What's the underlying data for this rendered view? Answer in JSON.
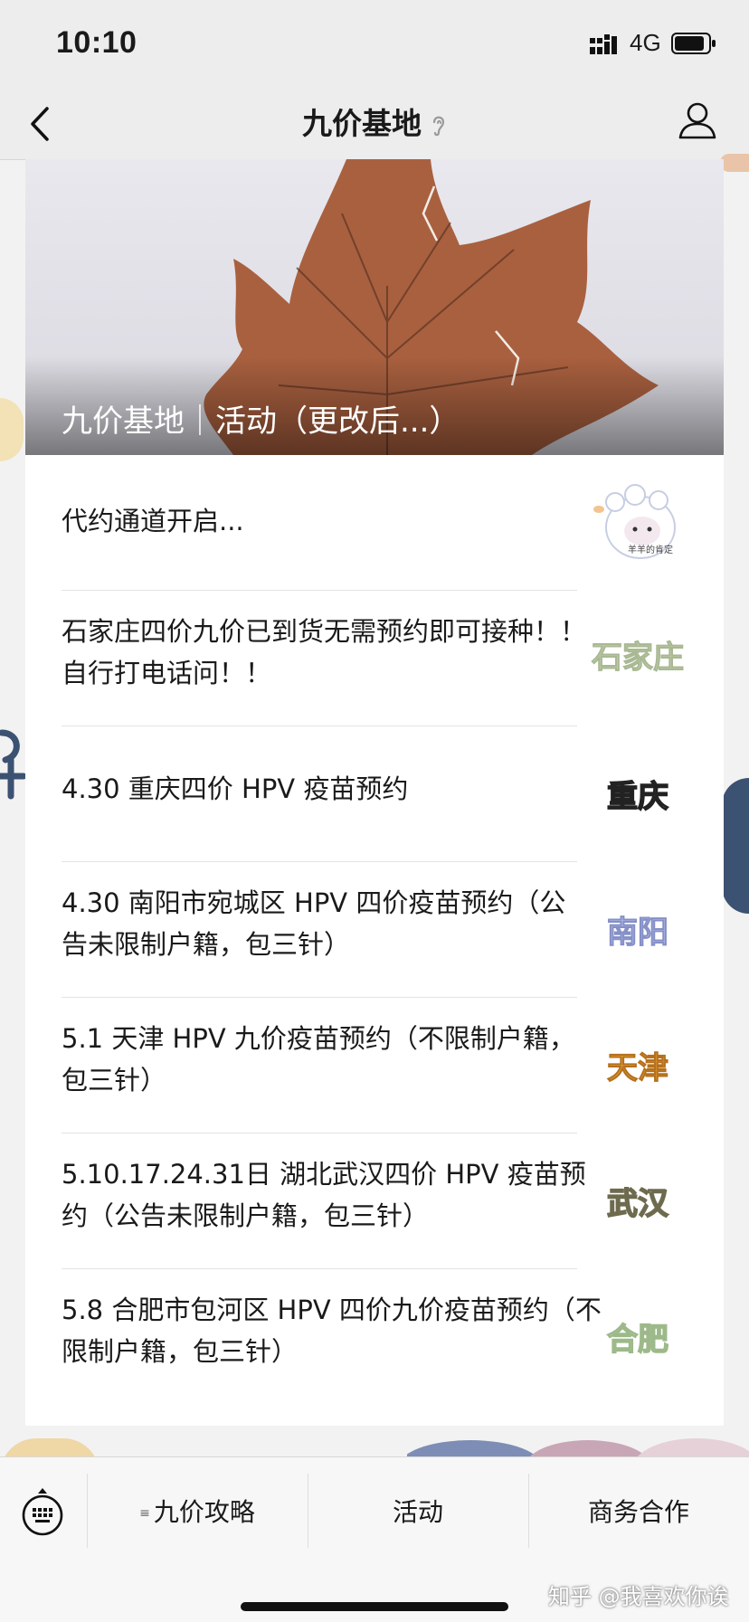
{
  "status": {
    "time": "10:10",
    "network": "4G"
  },
  "nav": {
    "title": "九价基地",
    "back_icon": "chevron-left-icon",
    "profile_icon": "person-icon",
    "ear_icon": "listen-icon"
  },
  "banner": {
    "title": "九价基地｜活动（更改后...）"
  },
  "articles": [
    {
      "title": "代约通道开启...",
      "thumb_label": "羊羊的肯定",
      "thumb_kind": "sheep-illustration"
    },
    {
      "title": "石家庄四价九价已到货无需预约即可接种！！自行打电话问！！",
      "thumb_label": "石家庄",
      "thumb_color": "#c8d6b2"
    },
    {
      "title": "4.30 重庆四价 HPV 疫苗预约",
      "thumb_label": "重庆",
      "thumb_color": "#f1d24a"
    },
    {
      "title": "4.30 南阳市宛城区 HPV 四价疫苗预约（公告未限制户籍，包三针）",
      "thumb_label": "南阳",
      "thumb_color": "#aeb8e6"
    },
    {
      "title": "5.1 天津 HPV 九价疫苗预约（不限制户籍，包三针）",
      "thumb_label": "天津",
      "thumb_color": "#f0a738"
    },
    {
      "title": "5.10.17.24.31日 湖北武汉四价 HPV 疫苗预约（公告未限制户籍，包三针）",
      "thumb_label": "武汉",
      "thumb_color": "#d9d5ad"
    },
    {
      "title": "5.8 合肥市包河区 HPV 四价九价疫苗预约（不限制户籍，包三针）",
      "thumb_label": "合肥",
      "thumb_color": "#cfe0bf"
    }
  ],
  "menu": {
    "keyboard_icon": "keyboard-icon",
    "items": [
      "九价攻略",
      "活动",
      "商务合作"
    ]
  },
  "watermark": "知乎 @我喜欢你诶"
}
